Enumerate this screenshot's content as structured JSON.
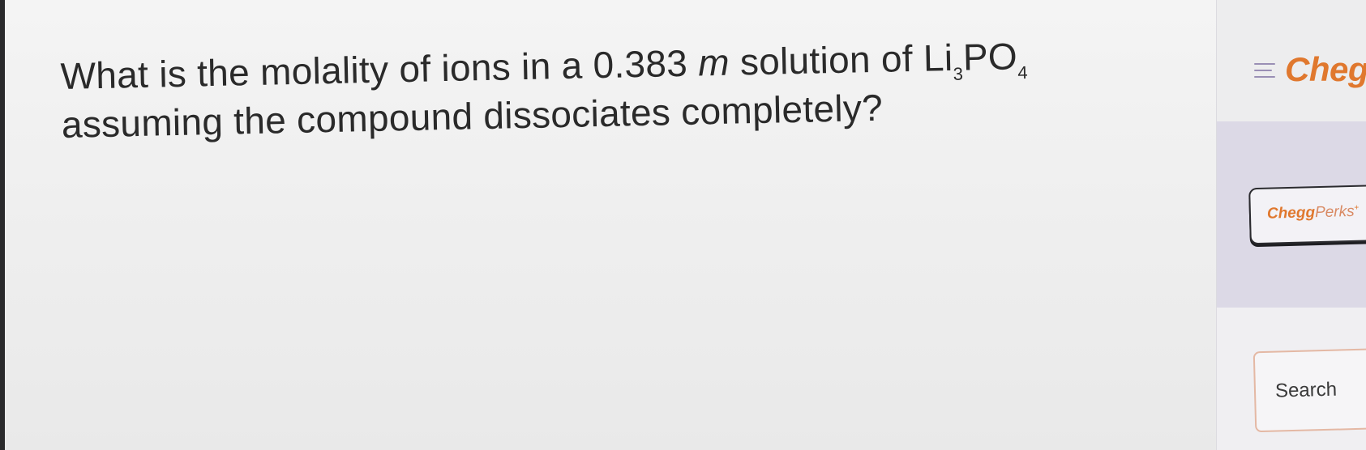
{
  "question": {
    "line1_before": "What is the molality of ions in a 0.383 ",
    "line1_unit": "m",
    "line1_after": " solution of Li",
    "formula_sub1": "3",
    "formula_mid": "PO",
    "formula_sub2": "4",
    "line2": "assuming the compound dissociates completely?"
  },
  "sidebar": {
    "brand": "Chegg",
    "menu_icon": "hamburger-menu-icon",
    "perks": {
      "brand_part": "Chegg",
      "perks_part": "Perks",
      "superscript": "+"
    },
    "search_label": "Search"
  },
  "colors": {
    "brand_orange": "#e0782e",
    "perks_band": "#dcd9e6",
    "search_border": "#e4b8a4"
  }
}
